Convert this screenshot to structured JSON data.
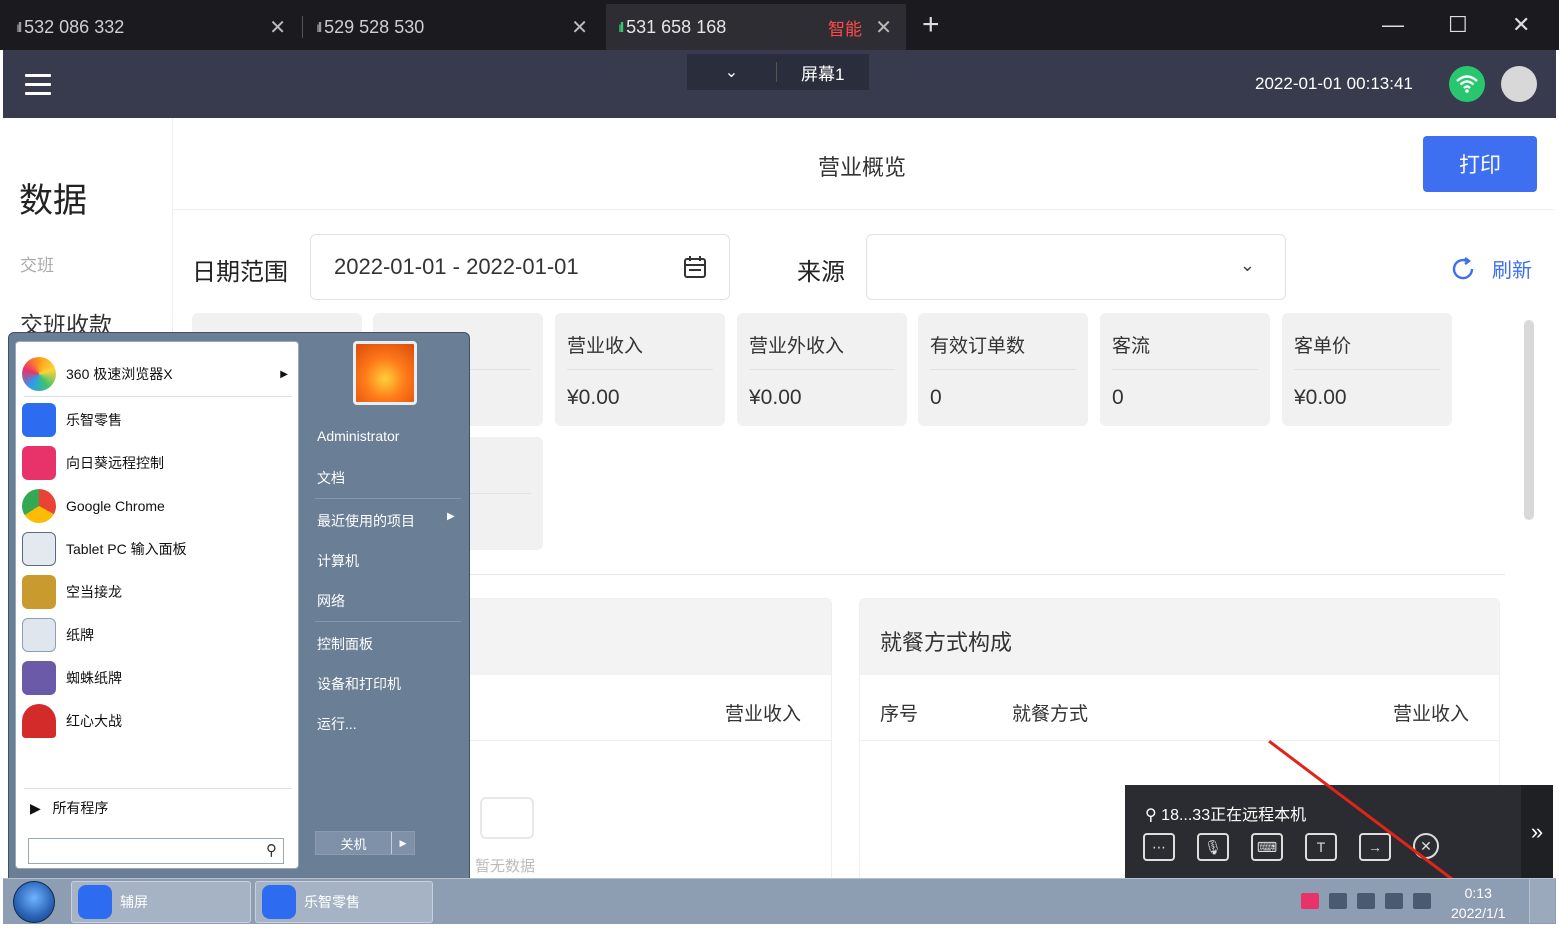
{
  "browser": {
    "tabs": [
      {
        "label": "532 086 332",
        "active": false
      },
      {
        "label": "529 528 530",
        "active": false
      },
      {
        "label": "531 658 168",
        "active": true,
        "badge": "智能"
      }
    ],
    "new_tab": "+",
    "close": "✕",
    "minimize": "—",
    "maximize": "☐",
    "window_close": "✕"
  },
  "header": {
    "screen_label": "屏幕1",
    "datetime": "2022-01-01 00:13:41"
  },
  "sidebar": {
    "title": "数据",
    "items": [
      "交班",
      "交班收款"
    ]
  },
  "main": {
    "title": "营业概览",
    "print": "打印",
    "date_label": "日期范围",
    "date_value": "2022-01-01 - 2022-01-01",
    "source_label": "来源",
    "source_value": "",
    "refresh": "刷新",
    "stats": [
      {
        "key": "营业收入",
        "value": "¥0.00"
      },
      {
        "key": "营业外收入",
        "value": "¥0.00"
      },
      {
        "key": "有效订单数",
        "value": "0"
      },
      {
        "key": "客流",
        "value": "0"
      },
      {
        "key": "客单价",
        "value": "¥0.00"
      }
    ],
    "left_panel": {
      "col_revenue": "营业收入",
      "no_data": "暂无数据"
    },
    "dining_panel": {
      "title": "就餐方式构成",
      "cols": [
        "序号",
        "就餐方式",
        "营业收入"
      ]
    }
  },
  "remote": {
    "status": "18...33正在远程本机",
    "expand": "»"
  },
  "start_menu": {
    "programs": [
      {
        "label": "360 极速浏览器X",
        "has_submenu": true,
        "color": "#ff9a1a"
      },
      {
        "label": "乐智零售",
        "color": "#2d6bf1"
      },
      {
        "label": "向日葵远程控制",
        "color": "#e8336a"
      },
      {
        "label": "Google Chrome",
        "color": "#34a853"
      },
      {
        "label": "Tablet PC 输入面板",
        "color": "#5a6b80"
      },
      {
        "label": "空当接龙",
        "color": "#c99a2e"
      },
      {
        "label": "纸牌",
        "color": "#8aa0b8"
      },
      {
        "label": "蜘蛛纸牌",
        "color": "#6a5aa8"
      },
      {
        "label": "红心大战",
        "color": "#d32a2a"
      }
    ],
    "all_programs": "所有程序",
    "right_items": [
      "Administrator",
      "文档",
      "最近使用的项目",
      "计算机",
      "网络",
      "控制面板",
      "设备和打印机",
      "运行..."
    ],
    "shutdown": "关机"
  },
  "taskbar": {
    "items": [
      "辅屏",
      "乐智零售"
    ],
    "time": "0:13",
    "date": "2022/1/1"
  }
}
